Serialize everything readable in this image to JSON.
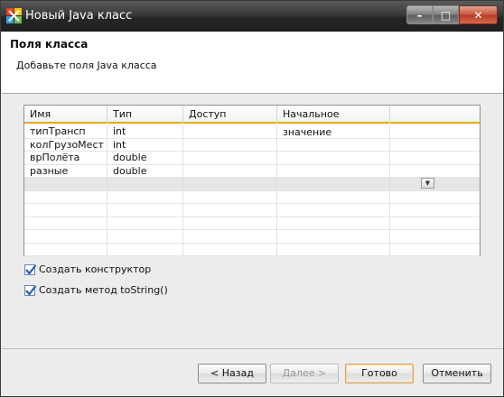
{
  "window": {
    "title": "Новый Java класс"
  },
  "banner": {
    "title": "Поля класса",
    "subtitle": "Добавьте поля Java класса"
  },
  "table": {
    "columns": [
      "Имя",
      "Тип",
      "Доступ",
      "Начальное значение",
      ""
    ],
    "rows": [
      [
        "типТрансп",
        "int",
        "",
        "",
        ""
      ],
      [
        "колГрузоМест",
        "int",
        "",
        "",
        ""
      ],
      [
        "врПолёта",
        "double",
        "",
        "",
        ""
      ],
      [
        "разные",
        "double",
        "",
        "",
        ""
      ]
    ],
    "dropdown_icon": "chevron-down-icon"
  },
  "options": {
    "create_constructor": {
      "label": "Создать конструктор",
      "checked": true
    },
    "create_tostring": {
      "label": "Создать метод toString()",
      "checked": true
    }
  },
  "buttons": {
    "back": "< Назад",
    "next": "Далее >",
    "finish": "Готово",
    "cancel": "Отменить"
  },
  "colors": {
    "header_accent": "#e7a33a",
    "checkbox_check": "#2a5db0"
  }
}
